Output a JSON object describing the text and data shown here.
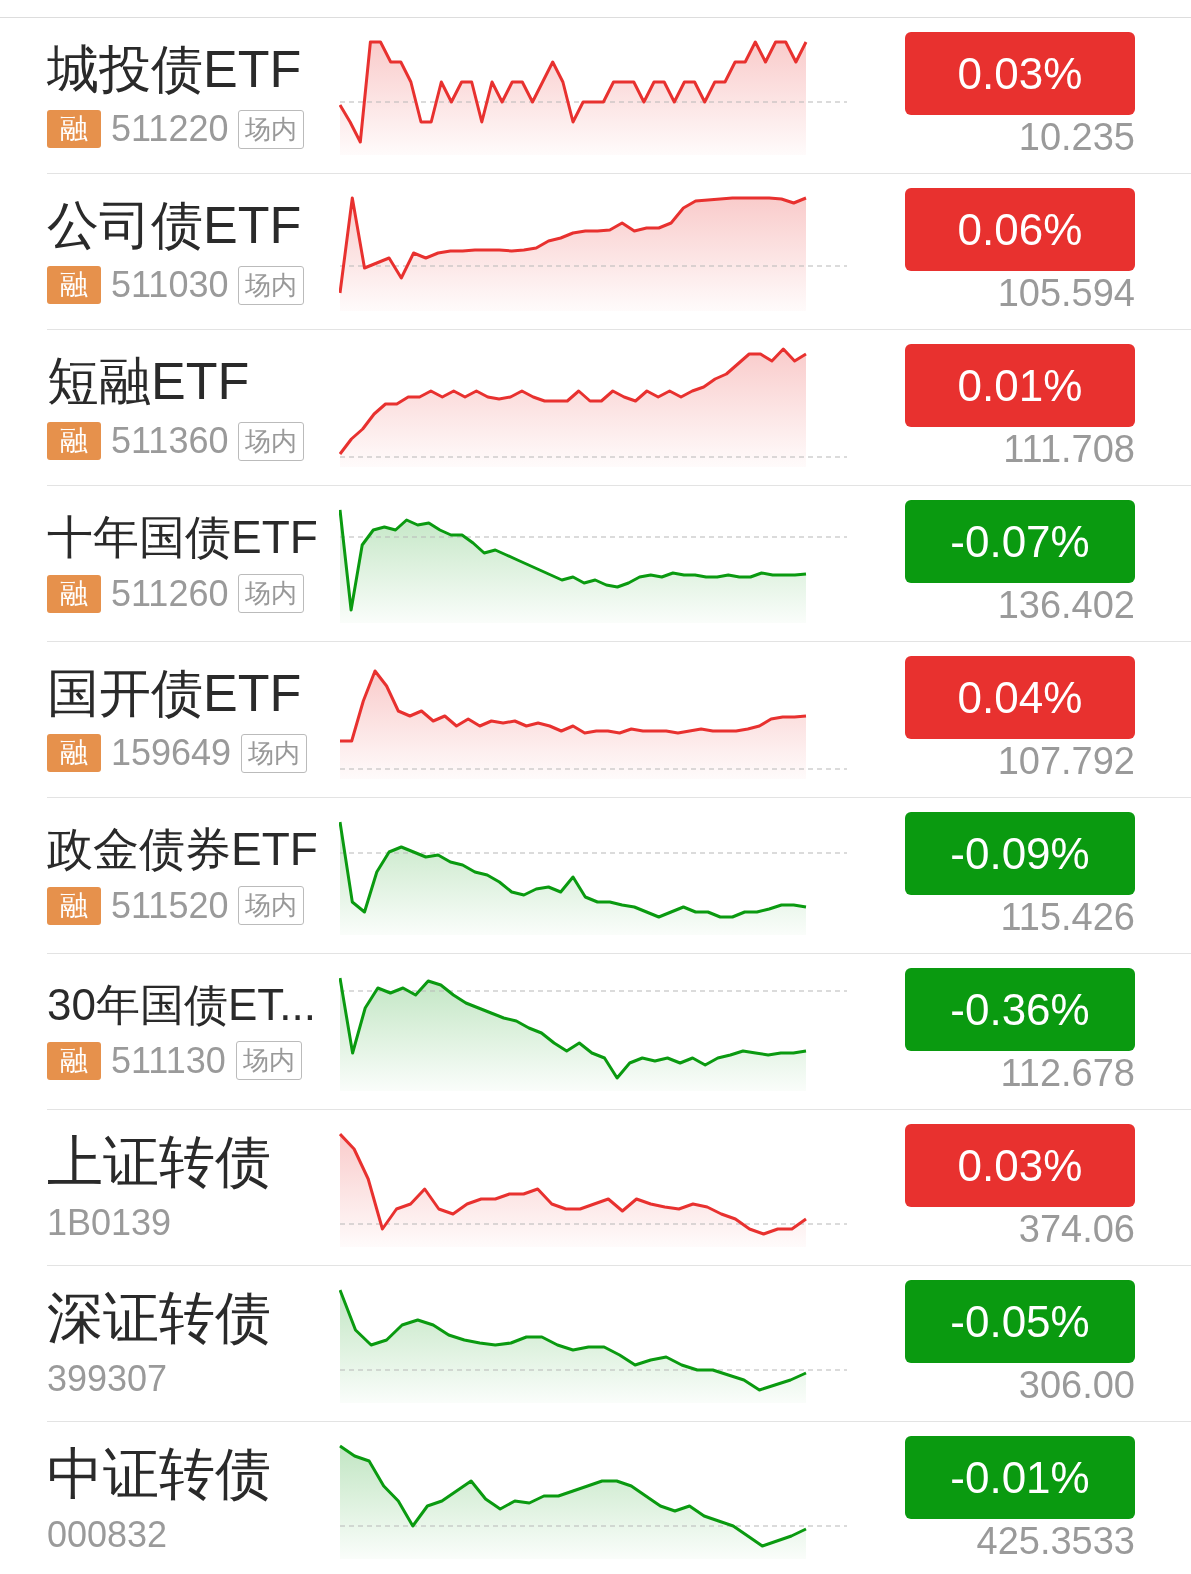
{
  "rows": [
    {
      "name": "城投债ETF",
      "margin_tag": "融",
      "code": "511220",
      "venue_tag": "场内",
      "change": "0.03%",
      "price": "10.235",
      "color": "#e8312f"
    },
    {
      "name": "公司债ETF",
      "margin_tag": "融",
      "code": "511030",
      "venue_tag": "场内",
      "change": "0.06%",
      "price": "105.594",
      "color": "#e8312f"
    },
    {
      "name": "短融ETF",
      "margin_tag": "融",
      "code": "511360",
      "venue_tag": "场内",
      "change": "0.01%",
      "price": "111.708",
      "color": "#e8312f"
    },
    {
      "name": "十年国债ETF",
      "margin_tag": "融",
      "code": "511260",
      "venue_tag": "场内",
      "change": "-0.07%",
      "price": "136.402",
      "color": "#0a9a10"
    },
    {
      "name": "国开债ETF",
      "margin_tag": "融",
      "code": "159649",
      "venue_tag": "场内",
      "change": "0.04%",
      "price": "107.792",
      "color": "#e8312f"
    },
    {
      "name": "政金债券ETF",
      "margin_tag": "融",
      "code": "511520",
      "venue_tag": "场内",
      "change": "-0.09%",
      "price": "115.426",
      "color": "#0a9a10"
    },
    {
      "name": "30年国债ET...",
      "margin_tag": "融",
      "code": "511130",
      "venue_tag": "场内",
      "change": "-0.36%",
      "price": "112.678",
      "color": "#0a9a10"
    },
    {
      "name": "上证转债",
      "code": "1B0139",
      "change": "0.03%",
      "price": "374.06",
      "color": "#e8312f"
    },
    {
      "name": "深证转债",
      "code": "399307",
      "change": "-0.05%",
      "price": "306.00",
      "color": "#0a9a10"
    },
    {
      "name": "中证转债",
      "code": "000832",
      "change": "-0.01%",
      "price": "425.3533",
      "color": "#0a9a10"
    }
  ]
}
